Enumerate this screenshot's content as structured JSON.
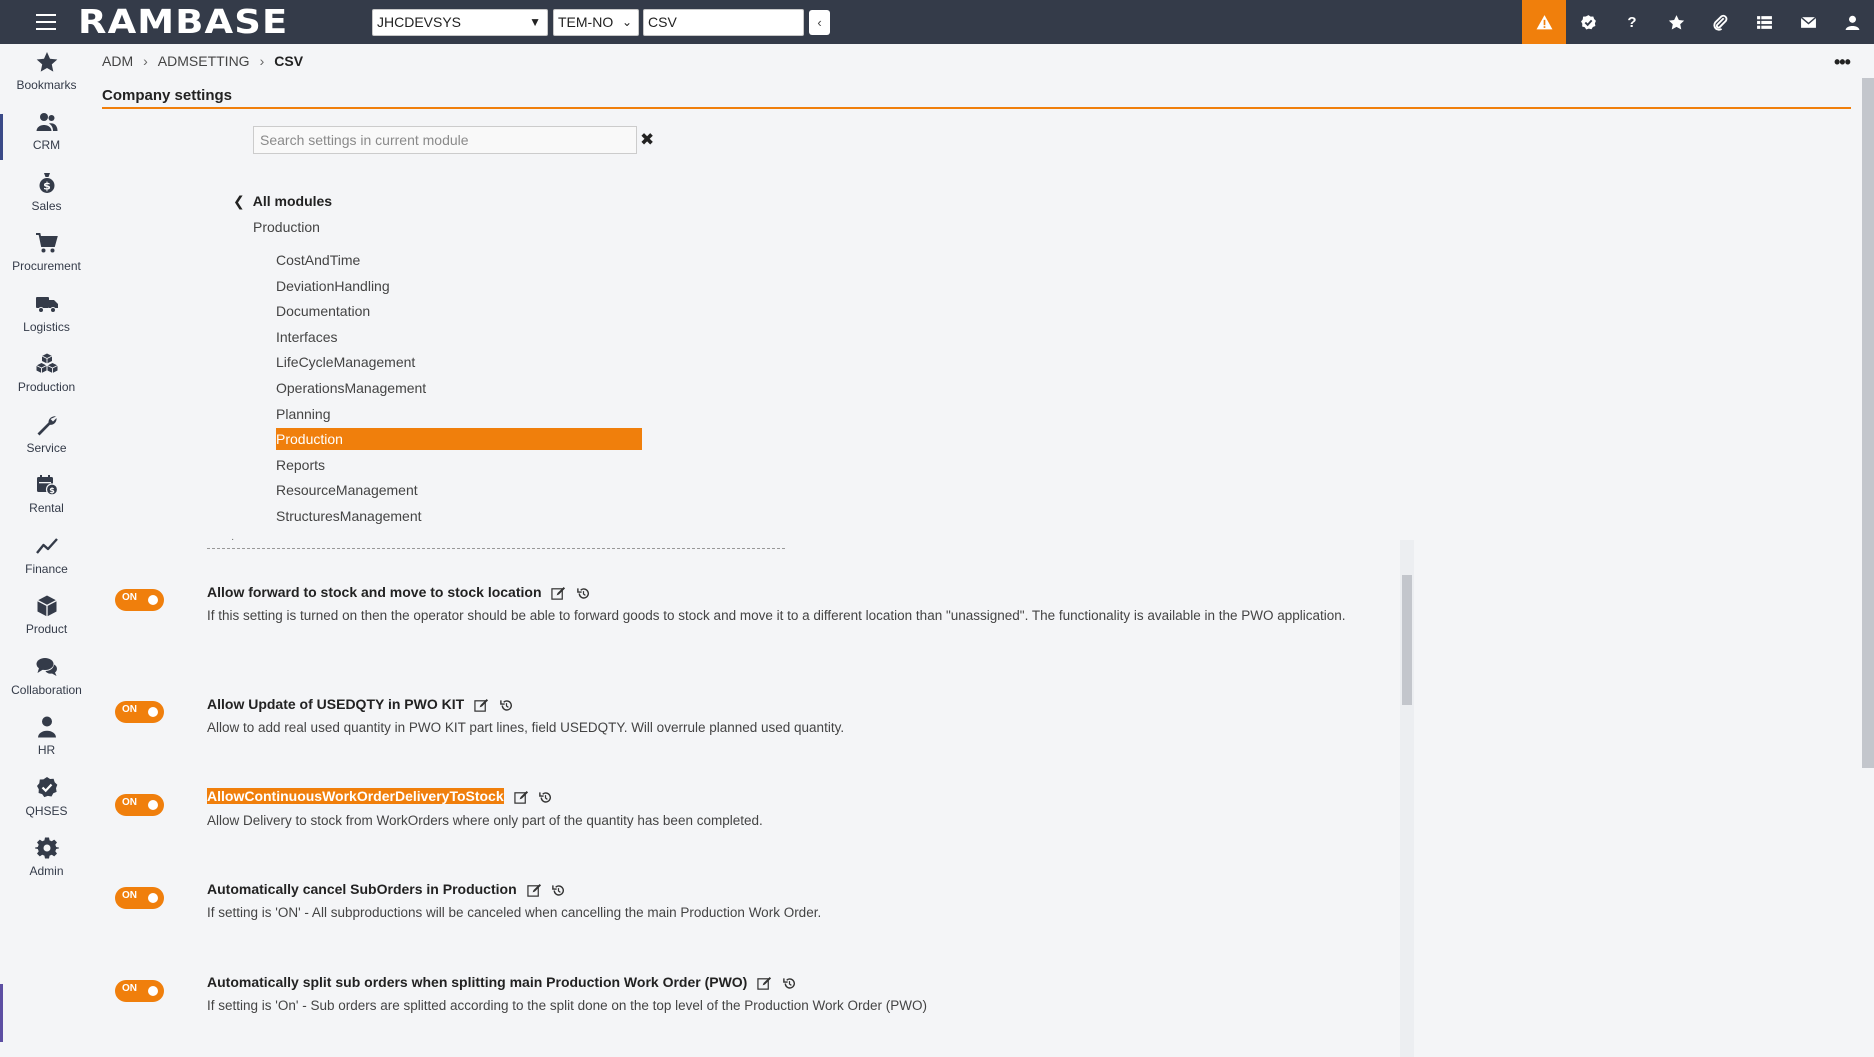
{
  "topbar": {
    "logo": "RAMBASE",
    "company_select": "JHCDEVSYS",
    "locale_select": "TEM-NO",
    "program_input": "CSV",
    "back_label": "‹"
  },
  "nav": {
    "items": [
      {
        "label": "Bookmarks"
      },
      {
        "label": "CRM"
      },
      {
        "label": "Sales"
      },
      {
        "label": "Procurement"
      },
      {
        "label": "Logistics"
      },
      {
        "label": "Production"
      },
      {
        "label": "Service"
      },
      {
        "label": "Rental"
      },
      {
        "label": "Finance"
      },
      {
        "label": "Product"
      },
      {
        "label": "Collaboration"
      },
      {
        "label": "HR"
      },
      {
        "label": "QHSES"
      },
      {
        "label": "Admin"
      }
    ]
  },
  "breadcrumb": {
    "items": [
      "ADM",
      "ADMSETTING"
    ],
    "current": "CSV",
    "more": "•••"
  },
  "page": {
    "title": "Company settings",
    "search_placeholder": "Search settings in current module",
    "search_clear": "✖"
  },
  "modules": {
    "back_label": "All modules",
    "current_module": "Production",
    "submodules": [
      "CostAndTime",
      "DeviationHandling",
      "Documentation",
      "Interfaces",
      "LifeCycleManagement",
      "OperationsManagement",
      "Planning",
      "Production",
      "Reports",
      "ResourceManagement",
      "StructuresManagement"
    ],
    "active_index": 7
  },
  "settings": [
    {
      "title": "Allow forward to stock and move to stock location",
      "description": "If this setting is turned on then the operator should be able to forward goods to stock and move it to a different location than \"unassigned\". The functionality is available in the PWO application.",
      "state": "ON",
      "highlighted": false
    },
    {
      "title": "Allow Update of USEDQTY in PWO KIT",
      "description": "Allow to add real used quantity in PWO KIT part lines, field USEDQTY. Will overrule planned used quantity.",
      "state": "ON",
      "highlighted": false
    },
    {
      "title": "AllowContinuousWorkOrderDeliveryToStock",
      "description": "Allow Delivery to stock from WorkOrders where only part of the quantity has been completed.",
      "state": "ON",
      "highlighted": true
    },
    {
      "title": "Automatically cancel SubOrders in Production",
      "description": "If setting is 'ON' - All subproductions will be canceled when cancelling the main Production Work Order.",
      "state": "ON",
      "highlighted": false
    },
    {
      "title": "Automatically split sub orders when splitting main Production Work Order (PWO)",
      "description": "If setting is 'On' - Sub orders are splitted according to the split done on the top level of the Production Work Order (PWO)",
      "state": "ON",
      "highlighted": false
    }
  ],
  "colors": {
    "accent": "#f07f0c",
    "topbar": "#343b49"
  }
}
